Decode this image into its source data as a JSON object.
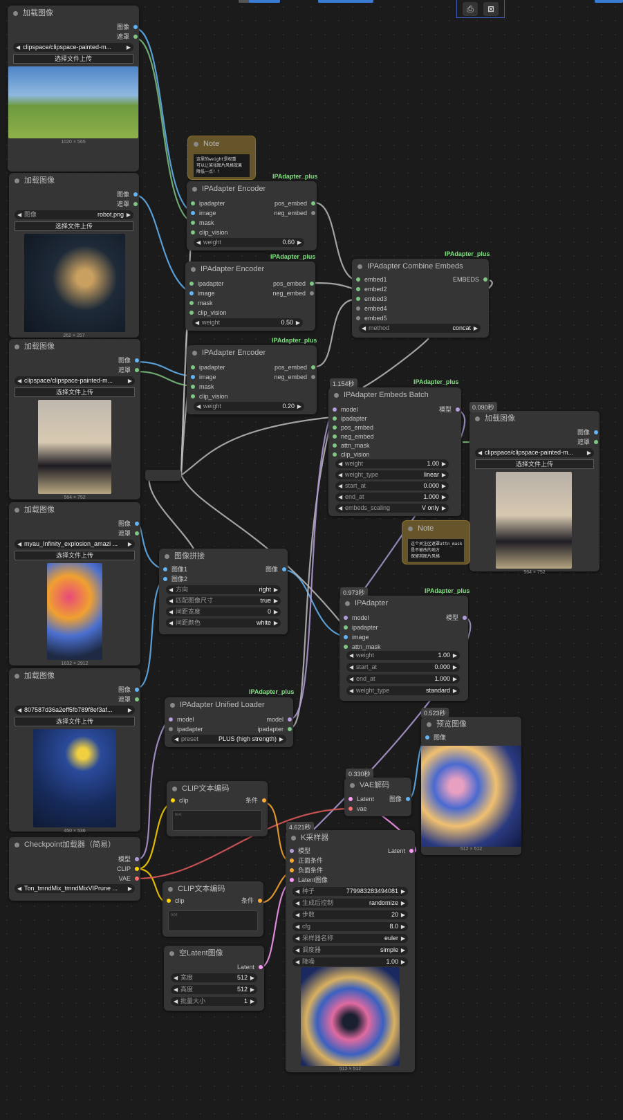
{
  "toolbar": {
    "icon1": "camera-add-icon",
    "icon2": "image-remove-icon"
  },
  "load1": {
    "title": "加载图像",
    "out_image": "图像",
    "out_mask": "遮罩",
    "file": "clipspace/clipspace-painted-m...",
    "upload": "选择文件上传",
    "dims": "1020 × 565"
  },
  "load2": {
    "title": "加载图像",
    "out_image": "图像",
    "out_mask": "遮罩",
    "file_label": "图像",
    "file": "robot.png",
    "upload": "选择文件上传",
    "dims": "262 × 257"
  },
  "load3": {
    "title": "加载图像",
    "out_image": "图像",
    "out_mask": "遮罩",
    "file": "clipspace/clipspace-painted-m...",
    "upload": "选择文件上传",
    "dims": "564 × 752"
  },
  "load4": {
    "title": "加载图像",
    "out_image": "图像",
    "out_mask": "遮罩",
    "file": "myau_Infinity_explosion_amazi ...",
    "upload": "选择文件上传",
    "dims": "1632 × 2912"
  },
  "load5": {
    "title": "加载图像",
    "out_image": "图像",
    "out_mask": "遮罩",
    "file": "807587d36a2eff5fb789f8ef3af...",
    "upload": "选择文件上传",
    "dims": "450 × 536"
  },
  "load6": {
    "title": "加载图像",
    "timer": "0.090秒",
    "out_image": "图像",
    "out_mask": "遮罩",
    "file": "clipspace/clipspace-painted-m...",
    "upload": "选择文件上传",
    "dims": "564 × 752"
  },
  "note1": {
    "title": "Note",
    "text": "这里的weight是权重\n可以让某张图片风格效果\n降低一点！！"
  },
  "note2": {
    "title": "Note",
    "text": "这个关注区遮罩attn_mask\n是不被改的地方\n保留其图片风格"
  },
  "enc1": {
    "badge": "IPAdapter_plus",
    "title": "IPAdapter Encoder",
    "in": [
      "ipadapter",
      "image",
      "mask",
      "clip_vision"
    ],
    "out": [
      "pos_embed",
      "neg_embed"
    ],
    "w_label": "weight",
    "w_value": "0.60"
  },
  "enc2": {
    "badge": "IPAdapter_plus",
    "title": "IPAdapter Encoder",
    "in": [
      "ipadapter",
      "image",
      "mask",
      "clip_vision"
    ],
    "out": [
      "pos_embed",
      "neg_embed"
    ],
    "w_label": "weight",
    "w_value": "0.50"
  },
  "enc3": {
    "badge": "IPAdapter_plus",
    "title": "IPAdapter Encoder",
    "in": [
      "ipadapter",
      "image",
      "mask",
      "clip_vision"
    ],
    "out": [
      "pos_embed",
      "neg_embed"
    ],
    "w_label": "weight",
    "w_value": "0.20"
  },
  "combine": {
    "badge": "IPAdapter_plus",
    "title": "IPAdapter Combine Embeds",
    "in": [
      "embed1",
      "embed2",
      "embed3",
      "embed4",
      "embed5"
    ],
    "out": "EMBEDS",
    "method_label": "method",
    "method_value": "concat"
  },
  "batch": {
    "badge": "IPAdapter_plus",
    "timer": "1.154秒",
    "title": "IPAdapter Embeds Batch",
    "in": [
      "model",
      "ipadapter",
      "pos_embed",
      "neg_embed",
      "attn_mask",
      "clip_vision"
    ],
    "out": "模型",
    "widgets": [
      {
        "label": "weight",
        "value": "1.00"
      },
      {
        "label": "weight_type",
        "value": "linear"
      },
      {
        "label": "start_at",
        "value": "0.000"
      },
      {
        "label": "end_at",
        "value": "1.000"
      },
      {
        "label": "embeds_scaling",
        "value": "V only"
      }
    ]
  },
  "stitch": {
    "title": "图像拼接",
    "in": [
      "图像1",
      "图像2"
    ],
    "out": "图像",
    "widgets": [
      {
        "label": "方向",
        "value": "right"
      },
      {
        "label": "匹配图像尺寸",
        "value": "true"
      },
      {
        "label": "间距宽度",
        "value": "0"
      },
      {
        "label": "间距颜色",
        "value": "white"
      }
    ]
  },
  "ipa": {
    "badge": "IPAdapter_plus",
    "timer": "0.973秒",
    "title": "IPAdapter",
    "in": [
      "model",
      "ipadapter",
      "image",
      "attn_mask"
    ],
    "out": "模型",
    "widgets": [
      {
        "label": "weight",
        "value": "1.00"
      },
      {
        "label": "start_at",
        "value": "0.000"
      },
      {
        "label": "end_at",
        "value": "1.000"
      },
      {
        "label": "weight_type",
        "value": "standard"
      }
    ]
  },
  "loader": {
    "badge": "IPAdapter_plus",
    "title": "IPAdapter Unified Loader",
    "in": [
      "model",
      "ipadapter"
    ],
    "out": [
      "model",
      "ipadapter"
    ],
    "preset_label": "preset",
    "preset_value": "PLUS (high strength)"
  },
  "clip1": {
    "title": "CLIP文本编码",
    "in": "clip",
    "out": "条件",
    "text": "text"
  },
  "clip2": {
    "title": "CLIP文本编码",
    "in": "clip",
    "out": "条件",
    "text": "text"
  },
  "ckpt": {
    "title": "Checkpoint加载器（简易）",
    "out": [
      "模型",
      "CLIP",
      "VAE"
    ],
    "file": "Ton_tmndMix_tmndMixVIPrune ..."
  },
  "latent": {
    "title": "空Latent图像",
    "out": "Latent",
    "widgets": [
      {
        "label": "宽度",
        "value": "512"
      },
      {
        "label": "高度",
        "value": "512"
      },
      {
        "label": "批量大小",
        "value": "1"
      }
    ]
  },
  "vae": {
    "timer": "0.330秒",
    "title": "VAE解码",
    "in": [
      "Latent",
      "vae"
    ],
    "out": "图像"
  },
  "preview": {
    "timer": "0.523秒",
    "title": "预览图像",
    "in": "图像",
    "dims": "512 × 512"
  },
  "ksampler": {
    "timer": "4.621秒",
    "title": "K采样器",
    "in": [
      "模型",
      "正面条件",
      "负面条件",
      "Latent图像"
    ],
    "out": "Latent",
    "widgets": [
      {
        "label": "种子",
        "value": "779983283494081"
      },
      {
        "label": "生成后控制",
        "value": "randomize"
      },
      {
        "label": "步数",
        "value": "20"
      },
      {
        "label": "cfg",
        "value": "8.0"
      },
      {
        "label": "采样器名称",
        "value": "euler"
      },
      {
        "label": "调度器",
        "value": "simple"
      },
      {
        "label": "降噪",
        "value": "1.00"
      }
    ],
    "dims": "512 × 512"
  },
  "colors": {
    "image": "#64b5f6",
    "mask": "#81c784",
    "clip": "#ffd500",
    "conditioning": "#ffa931",
    "latent": "#ff9cf9",
    "vae": "#ff6e6e",
    "model": "#b39ddb",
    "ipadapter_wire": "#8a9c8a",
    "badge": "#7fe07f"
  }
}
